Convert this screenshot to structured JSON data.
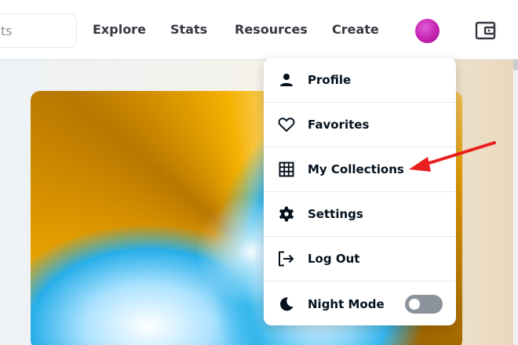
{
  "search": {
    "placeholder_fragment": "ts"
  },
  "nav": {
    "explore": "Explore",
    "stats": "Stats",
    "resources": "Resources",
    "create": "Create"
  },
  "account_menu": {
    "items": [
      {
        "label": "Profile",
        "icon": "person-icon"
      },
      {
        "label": "Favorites",
        "icon": "heart-icon"
      },
      {
        "label": "My Collections",
        "icon": "grid-icon"
      },
      {
        "label": "Settings",
        "icon": "gear-icon"
      },
      {
        "label": "Log Out",
        "icon": "logout-icon"
      },
      {
        "label": "Night Mode",
        "icon": "moon-icon"
      }
    ],
    "night_mode_enabled": false
  },
  "colors": {
    "text_primary": "#04111d",
    "nav_text": "#353840",
    "toggle_off": "#8a939b",
    "annotation_arrow": "#e8201f",
    "avatar": "#c323b0"
  },
  "annotation": {
    "points_to": "My Collections"
  }
}
